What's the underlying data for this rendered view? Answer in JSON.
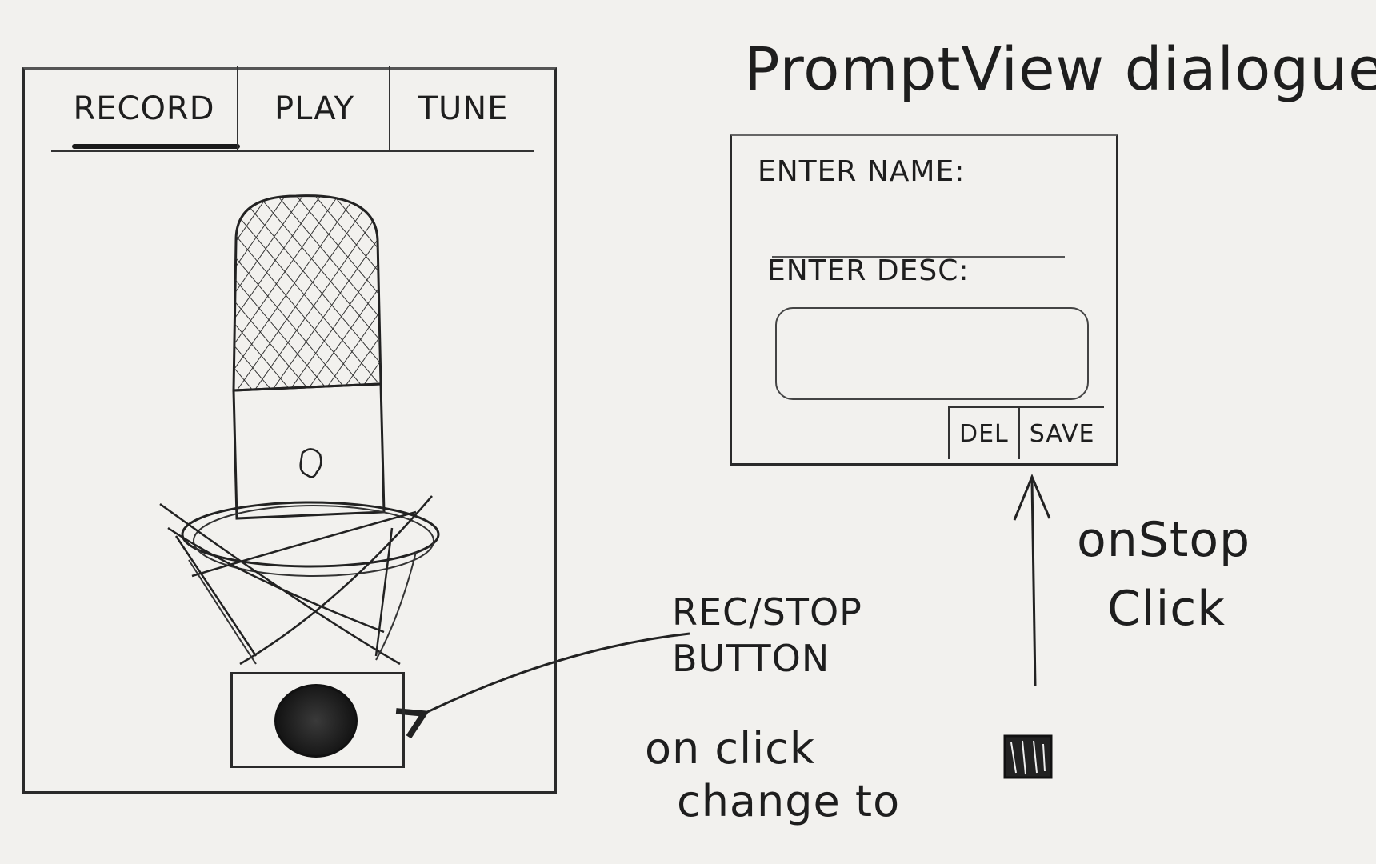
{
  "dialog_title": "PromptView dialogue",
  "tabs": [
    {
      "label": "RECORD",
      "active": true
    },
    {
      "label": "PLAY",
      "active": false
    },
    {
      "label": "TUNE",
      "active": false
    }
  ],
  "record_button": {
    "annotation": "REC/STOP BUTTON",
    "click_note_line1": "on click",
    "click_note_line2": "change to"
  },
  "prompt_dialog": {
    "name_label": "ENTER NAME:",
    "name_value": "",
    "desc_label": "ENTER DESC:",
    "desc_value": "",
    "delete_label": "DEL",
    "save_label": "SAVE"
  },
  "transition_note": {
    "line1": "onStop",
    "line2": "Click"
  },
  "icons": {
    "microphone": "microphone-icon",
    "record": "record-dot-icon",
    "stop": "stop-square-icon"
  },
  "colors": {
    "paper": "#f2f1ee",
    "ink": "#1e1e1e"
  }
}
